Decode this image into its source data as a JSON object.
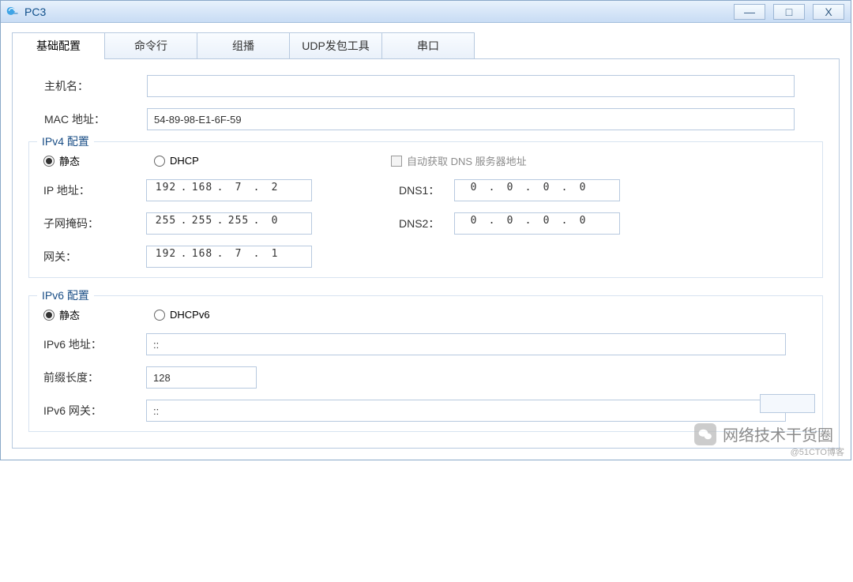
{
  "window": {
    "title": "PC3",
    "controls": {
      "minimize": "—",
      "maximize": "□",
      "close": "X"
    }
  },
  "tabs": [
    {
      "label": "基础配置",
      "active": true
    },
    {
      "label": "命令行",
      "active": false
    },
    {
      "label": "组播",
      "active": false
    },
    {
      "label": "UDP发包工具",
      "active": false
    },
    {
      "label": "串口",
      "active": false
    }
  ],
  "basic": {
    "hostnameLabel": "主机名：",
    "hostnameValue": "",
    "macLabel": "MAC 地址：",
    "macValue": "54-89-98-E1-6F-59"
  },
  "ipv4": {
    "groupTitle": "IPv4 配置",
    "radioStatic": {
      "label": "静态",
      "checked": true
    },
    "radioDhcp": {
      "label": "DHCP",
      "checked": false
    },
    "autoDnsCheckbox": {
      "label": "自动获取 DNS 服务器地址",
      "checked": false,
      "enabled": false
    },
    "ipLabel": "IP 地址：",
    "ip": {
      "a": "192",
      "b": "168",
      "c": "7",
      "d": "2"
    },
    "maskLabel": "子网掩码：",
    "mask": {
      "a": "255",
      "b": "255",
      "c": "255",
      "d": "0"
    },
    "gwLabel": "网关：",
    "gw": {
      "a": "192",
      "b": "168",
      "c": "7",
      "d": "1"
    },
    "dns1Label": "DNS1：",
    "dns1": {
      "a": "0",
      "b": "0",
      "c": "0",
      "d": "0"
    },
    "dns2Label": "DNS2：",
    "dns2": {
      "a": "0",
      "b": "0",
      "c": "0",
      "d": "0"
    }
  },
  "ipv6": {
    "groupTitle": "IPv6 配置",
    "radioStatic": {
      "label": "静态",
      "checked": true
    },
    "radioDhcp": {
      "label": "DHCPv6",
      "checked": false
    },
    "addrLabel": "IPv6 地址：",
    "addrValue": "::",
    "prefixLabel": "前缀长度：",
    "prefixValue": "128",
    "gwLabel": "IPv6 网关：",
    "gwValue": "::"
  },
  "watermark": {
    "text": "网络技术干货圈",
    "source": "@51CTO博客"
  }
}
